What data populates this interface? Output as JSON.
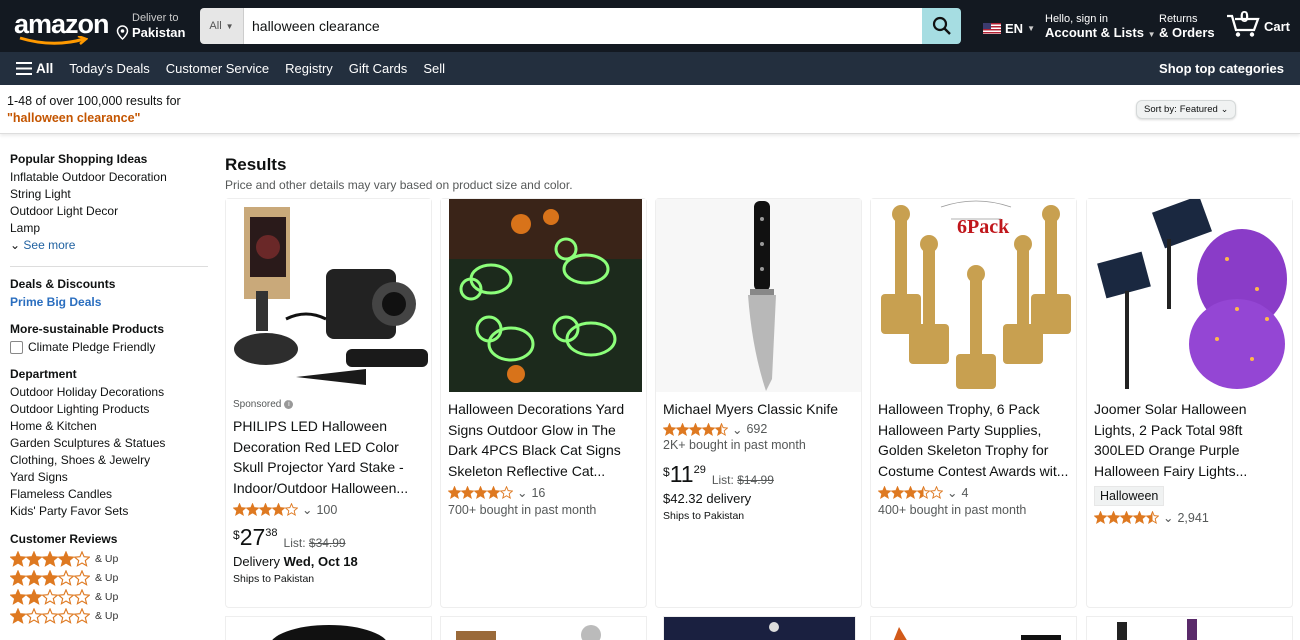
{
  "header": {
    "logo_text": "amazon",
    "deliver_small": "Deliver to",
    "deliver_location": "Pakistan",
    "search_category": "All",
    "search_value": "halloween clearance",
    "language": "EN",
    "account_small": "Hello, sign in",
    "account_big": "Account & Lists",
    "returns_small": "Returns",
    "returns_big": "& Orders",
    "cart_count": "0",
    "cart_label": "Cart"
  },
  "subnav": {
    "all_label": "All",
    "items": [
      "Today's Deals",
      "Customer Service",
      "Registry",
      "Gift Cards",
      "Sell"
    ],
    "right": "Shop top categories"
  },
  "results_bar": {
    "count_text": "1-48 of over 100,000 results for",
    "query_text": "\"halloween clearance\"",
    "sort_label": "Sort by:",
    "sort_value": "Featured"
  },
  "sidebar": {
    "popular_title": "Popular Shopping Ideas",
    "popular_items": [
      "Inflatable Outdoor Decoration",
      "String Light",
      "Outdoor Light Decor",
      "Lamp"
    ],
    "see_more": "See more",
    "deals_title": "Deals & Discounts",
    "deals_item": "Prime Big Deals",
    "sustainable_title": "More-sustainable Products",
    "sustainable_item": "Climate Pledge Friendly",
    "department_title": "Department",
    "department_items": [
      "Outdoor Holiday Decorations",
      "Outdoor Lighting Products",
      "Home & Kitchen",
      "Garden Sculptures & Statues",
      "Clothing, Shoes & Jewelry",
      "Yard Signs",
      "Flameless Candles",
      "Kids' Party Favor Sets"
    ],
    "reviews_title": "Customer Reviews",
    "reviews_up": "& Up",
    "review_filters": [
      4,
      3,
      2,
      1
    ]
  },
  "results": {
    "heading": "Results",
    "subheading": "Price and other details may vary based on product size and color."
  },
  "products": [
    {
      "sponsored": "Sponsored",
      "title_lines": [
        "PHILIPS LED Halloween",
        "Decoration Red LED Color",
        "Skull Projector Yard Stake -",
        "Indoor/Outdoor Halloween..."
      ],
      "rating": 4.0,
      "reviews": "100",
      "price_symbol": "$",
      "price_whole": "27",
      "price_frac": "38",
      "list_label": "List:",
      "list_price": "$34.99",
      "delivery_prefix": "Delivery",
      "delivery_date": "Wed, Oct 18",
      "ships": "Ships to Pakistan"
    },
    {
      "title_lines": [
        "Halloween Decorations Yard",
        "Signs Outdoor Glow in The",
        "Dark 4PCS Black Cat Signs",
        "Skeleton Reflective Cat..."
      ],
      "rating": 4.0,
      "reviews": "16",
      "bought": "700+ bought in past month"
    },
    {
      "title_lines": [
        "Michael Myers Classic Knife"
      ],
      "rating": 4.5,
      "reviews": "692",
      "bought": "2K+ bought in past month",
      "price_symbol": "$",
      "price_whole": "11",
      "price_frac": "29",
      "list_label": "List:",
      "list_price": "$14.99",
      "delivery": "$42.32 delivery",
      "ships": "Ships to Pakistan"
    },
    {
      "title_lines": [
        "Halloween Trophy, 6 Pack",
        "Halloween Party Supplies,",
        "Golden Skeleton Trophy for",
        "Costume Contest Awards wit..."
      ],
      "rating": 3.5,
      "reviews": "4",
      "bought": "400+ bought in past month",
      "image_text": "6Pack"
    },
    {
      "title_lines": [
        "Joomer Solar Halloween",
        "Lights, 2 Pack Total 98ft",
        "300LED Orange Purple",
        "Halloween Fairy Lights..."
      ],
      "badge": "Halloween",
      "rating": 4.5,
      "reviews": "2,941"
    }
  ],
  "colors": {
    "nav_bg": "#131921",
    "subnav_bg": "#232f3e",
    "search_button": "#a6dde2",
    "star": "#de7921",
    "link_orange": "#c45500",
    "link_blue": "#2a6ebf"
  }
}
